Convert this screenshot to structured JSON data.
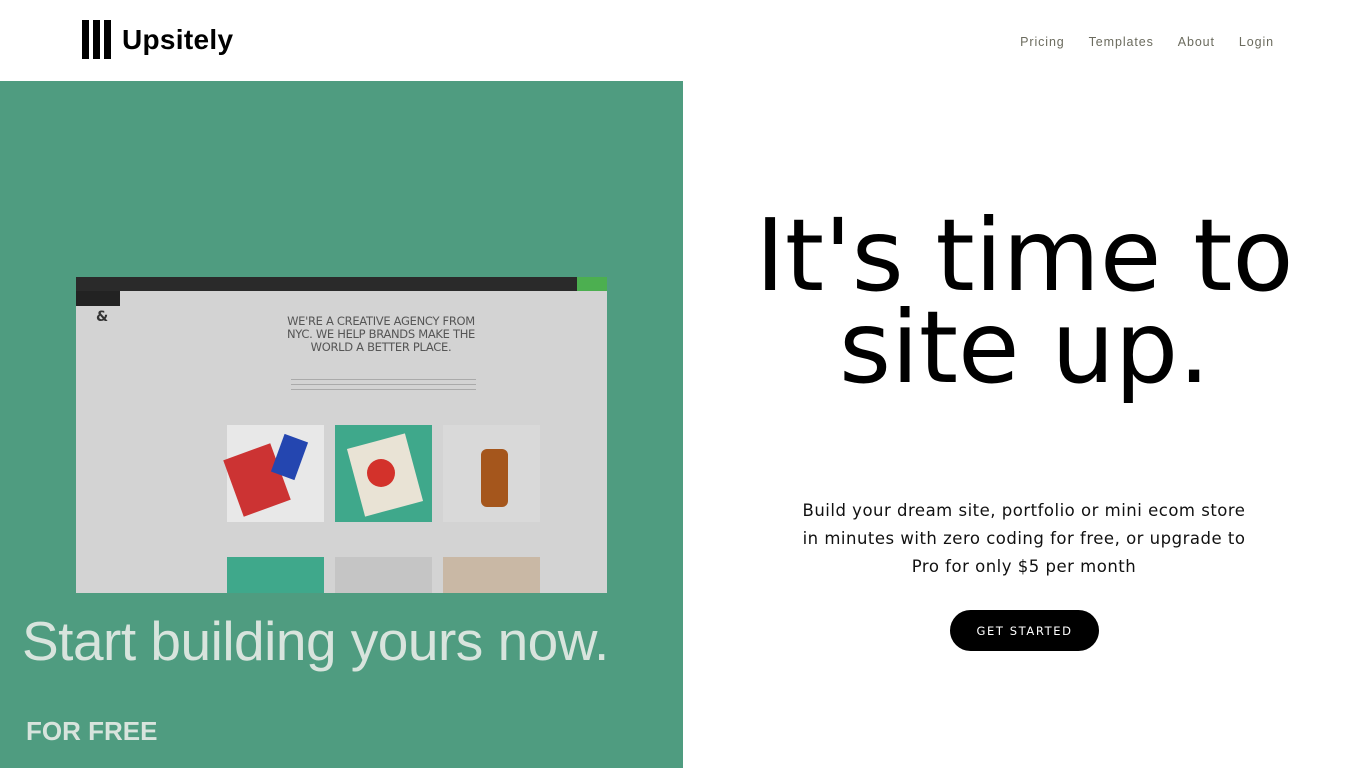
{
  "brand": {
    "name": "Upsitely"
  },
  "nav": {
    "items": [
      {
        "label": "Pricing"
      },
      {
        "label": "Templates"
      },
      {
        "label": "About"
      },
      {
        "label": "Login"
      }
    ]
  },
  "hero_image": {
    "mock_headline": "WE'RE A CREATIVE AGENCY FROM NYC. WE HELP BRANDS MAKE THE WORLD A BETTER PLACE.",
    "caption": "Start building yours now.",
    "caption_sub": "FOR FREE",
    "background_color": "#4f9c80"
  },
  "hero": {
    "headline": "It's time to site up.",
    "subtext": "Build your dream site, portfolio or mini ecom store in minutes with zero coding for free, or upgrade to Pro for only $5 per month",
    "cta_label": "GET STARTED"
  }
}
